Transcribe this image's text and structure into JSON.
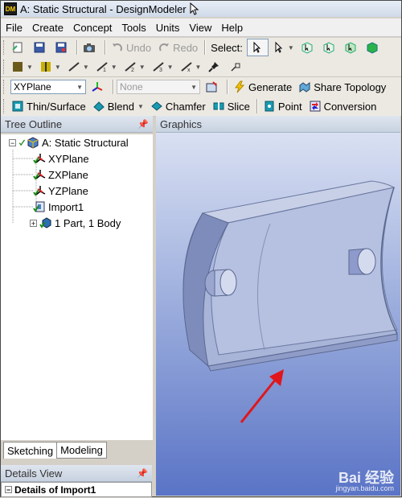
{
  "window": {
    "title": "A: Static Structural - DesignModeler",
    "app_badge": "DM"
  },
  "menu": [
    "File",
    "Create",
    "Concept",
    "Tools",
    "Units",
    "View",
    "Help"
  ],
  "toolbar1": {
    "undo": "Undo",
    "redo": "Redo",
    "select_label": "Select:"
  },
  "toolbar3": {
    "plane_value": "XYPlane",
    "sketch_value": "None",
    "generate": "Generate",
    "share_topology": "Share Topology"
  },
  "toolbar4": {
    "thin_surface": "Thin/Surface",
    "blend": "Blend",
    "chamfer": "Chamfer",
    "slice": "Slice",
    "point": "Point",
    "conversion": "Conversion"
  },
  "tree_outline": {
    "title": "Tree Outline",
    "root": "A: Static Structural",
    "items": [
      "XYPlane",
      "ZXPlane",
      "YZPlane",
      "Import1",
      "1 Part, 1 Body"
    ]
  },
  "graphics": {
    "title": "Graphics"
  },
  "tabs": {
    "sketching": "Sketching",
    "modeling": "Modeling"
  },
  "details": {
    "title": "Details View",
    "row": "Details of Import1"
  },
  "watermark": {
    "brand": "Bai 经验",
    "site": "jingyan.baidu.com"
  },
  "colors": {
    "accent_red": "#e0161b",
    "graphics_top": "#d9e0f2",
    "graphics_bottom": "#5a74c6"
  }
}
